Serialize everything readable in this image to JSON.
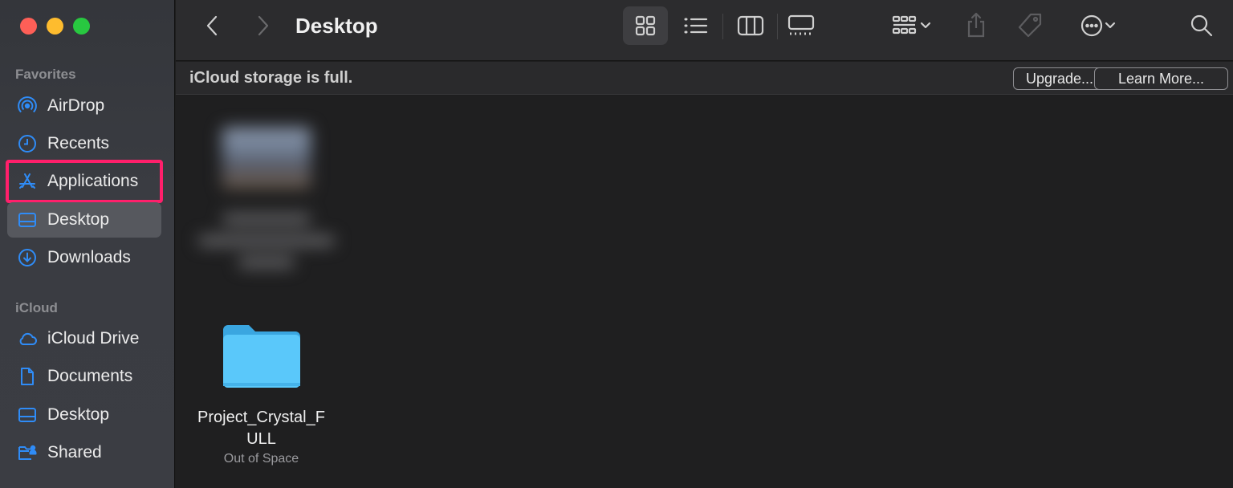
{
  "window": {
    "title": "Desktop"
  },
  "sidebar": {
    "sections": [
      {
        "label": "Favorites",
        "items": [
          {
            "label": "AirDrop",
            "icon": "airdrop-icon"
          },
          {
            "label": "Recents",
            "icon": "clock-icon"
          },
          {
            "label": "Applications",
            "icon": "applications-icon"
          },
          {
            "label": "Desktop",
            "icon": "desktop-icon"
          },
          {
            "label": "Downloads",
            "icon": "download-icon"
          }
        ]
      },
      {
        "label": "iCloud",
        "items": [
          {
            "label": "iCloud Drive",
            "icon": "cloud-icon"
          },
          {
            "label": "Documents",
            "icon": "document-icon"
          },
          {
            "label": "Desktop",
            "icon": "desktop-icon"
          },
          {
            "label": "Shared",
            "icon": "shared-folder-icon"
          }
        ]
      }
    ],
    "selected_item": "Desktop",
    "highlighted_item": "Applications",
    "highlight_color": "#ff1f6b",
    "accent_color": "#2f8cf7"
  },
  "banner": {
    "message": "iCloud storage is full.",
    "upgrade_label": "Upgrade...",
    "learn_more_label": "Learn More..."
  },
  "files": [
    {
      "name": "Project_Crystal_F ULL",
      "name_line1": "Project_Crystal_F",
      "name_line2": "ULL",
      "subtitle": "Out of Space",
      "icon": "folder-icon",
      "folder_color": "#5ac8fa"
    }
  ]
}
